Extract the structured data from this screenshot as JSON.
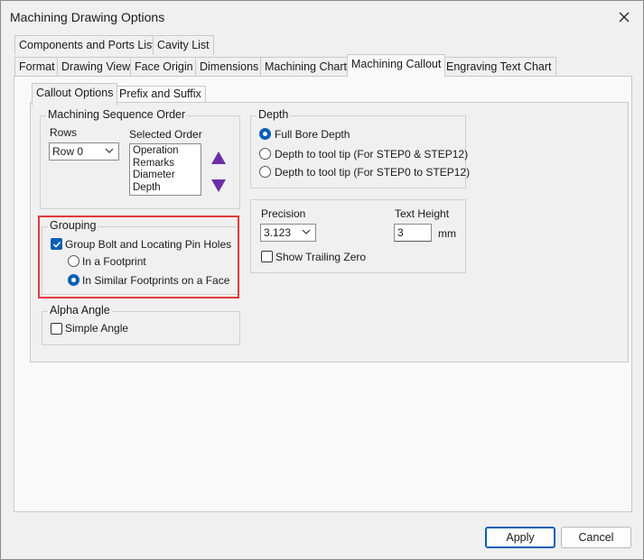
{
  "window": {
    "title": "Machining Drawing Options"
  },
  "tabs_row1": [
    "Components and Ports List",
    "Cavity List"
  ],
  "tabs_row2": [
    "Format",
    "Drawing View",
    "Face Origin",
    "Dimensions",
    "Machining Chart",
    "Machining Callout",
    "Engraving Text Chart"
  ],
  "active_tab": "Machining Callout",
  "subtabs": [
    "Callout Options",
    "Prefix and Suffix"
  ],
  "active_subtab": "Callout Options",
  "sequence": {
    "legend": "Machining Sequence Order",
    "rows_label": "Rows",
    "rows_value": "Row 0",
    "selected_label": "Selected Order",
    "selected_items": [
      "Operation",
      "Remarks",
      "Diameter",
      "Depth"
    ],
    "up_icon": "triangle-up-icon",
    "down_icon": "triangle-down-icon",
    "arrow_color": "#6a2fa8"
  },
  "grouping": {
    "legend": "Grouping",
    "group_bolt_label": "Group Bolt and Locating Pin Holes",
    "group_bolt_checked": true,
    "options": [
      "In a Footprint",
      "In Similar Footprints on a Face"
    ],
    "selected_option": "In Similar Footprints on a Face",
    "highlight_color": "#e23b3b"
  },
  "alpha": {
    "legend": "Alpha Angle",
    "simple_angle_label": "Simple Angle",
    "simple_angle_checked": false
  },
  "depth": {
    "legend": "Depth",
    "options": [
      "Full Bore Depth",
      "Depth to tool tip (For STEP0 & STEP12)",
      "Depth to tool tip (For STEP0 to STEP12)"
    ],
    "selected_option": "Full Bore Depth"
  },
  "precision": {
    "precision_label": "Precision",
    "precision_value": "3.123",
    "text_height_label": "Text Height",
    "text_height_value": "3",
    "unit": "mm",
    "trailing_zero_label": "Show Trailing Zero",
    "trailing_zero_checked": false
  },
  "buttons": {
    "apply": "Apply",
    "cancel": "Cancel"
  },
  "accent_color": "#0a5fb4"
}
